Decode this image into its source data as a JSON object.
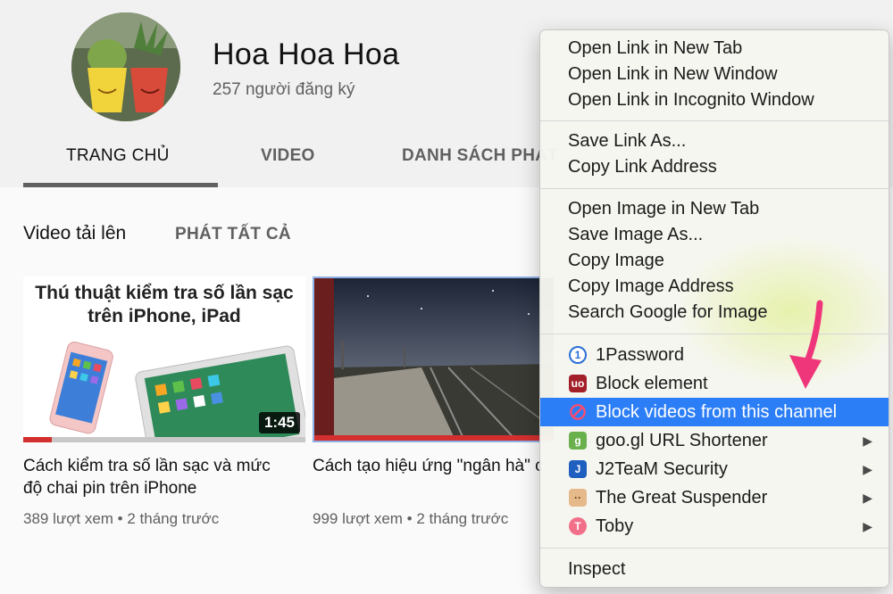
{
  "channel": {
    "name": "Hoa Hoa Hoa",
    "subscribers": "257 người đăng ký"
  },
  "tabs": [
    {
      "label": "TRANG CHỦ",
      "active": true
    },
    {
      "label": "VIDEO",
      "active": false
    },
    {
      "label": "DANH SÁCH PHÁT",
      "active": false
    }
  ],
  "uploads": {
    "title": "Video tải lên",
    "play_all": "PHÁT TẤT CẢ"
  },
  "videos": [
    {
      "thumb_text": "Thú thuật kiểm tra số lần sạc trên iPhone, iPad",
      "duration": "1:45",
      "watched": 0.1,
      "title": "Cách kiểm tra số lần sạc và mức độ chai pin trên iPhone",
      "meta": "389 lượt xem • 2 tháng trước"
    },
    {
      "thumb_text": "",
      "duration": "",
      "watched": 1.0,
      "title": "Cách tạo hiệu ứng \"ngân hà\" cho hình ảnh trong nháy mắt",
      "meta": "999 lượt xem • 2 tháng trước"
    }
  ],
  "context_menu": {
    "link_group": [
      "Open Link in New Tab",
      "Open Link in New Window",
      "Open Link in Incognito Window"
    ],
    "save_group": [
      "Save Link As...",
      "Copy Link Address"
    ],
    "image_group": [
      "Open Image in New Tab",
      "Save Image As...",
      "Copy Image",
      "Copy Image Address",
      "Search Google for Image"
    ],
    "extensions": [
      {
        "label": "1Password",
        "icon": "1password-icon",
        "submenu": false,
        "highlighted": false
      },
      {
        "label": "Block element",
        "icon": "ublock-icon",
        "submenu": false,
        "highlighted": false
      },
      {
        "label": "Block videos from this channel",
        "icon": "block-icon",
        "submenu": false,
        "highlighted": true
      },
      {
        "label": "goo.gl URL Shortener",
        "icon": "googl-icon",
        "submenu": true,
        "highlighted": false
      },
      {
        "label": "J2TeaM Security",
        "icon": "j2team-icon",
        "submenu": true,
        "highlighted": false
      },
      {
        "label": "The Great Suspender",
        "icon": "suspender-icon",
        "submenu": true,
        "highlighted": false
      },
      {
        "label": "Toby",
        "icon": "toby-icon",
        "submenu": true,
        "highlighted": false
      }
    ],
    "inspect": "Inspect"
  },
  "colors": {
    "highlight": "#2c7ef7",
    "pointer": "#f0367a",
    "progress": "#d32f2f"
  }
}
